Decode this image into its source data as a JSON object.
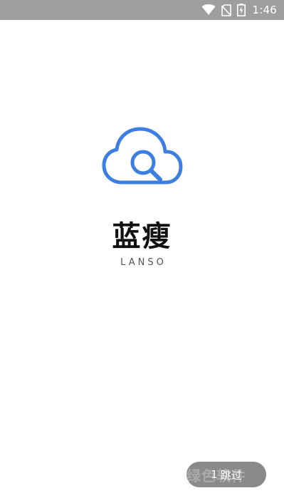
{
  "status_bar": {
    "time": "1:46",
    "icons": [
      "wifi-icon",
      "no-sim-icon",
      "battery-charging-icon"
    ]
  },
  "logo": {
    "icon": "cloud-search-icon",
    "color": "#3d7fe0"
  },
  "brand": {
    "name": "蓝瘦",
    "subtitle": "LANSO"
  },
  "skip": {
    "count": "1",
    "label": "跳过"
  },
  "watermark": {
    "text": "绿色软件"
  }
}
